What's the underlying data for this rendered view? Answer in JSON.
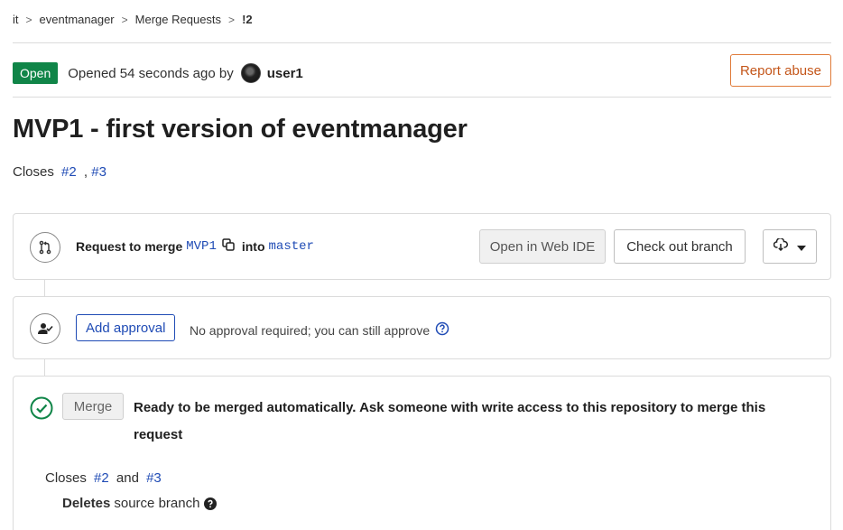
{
  "breadcrumb": {
    "items": [
      "it",
      "eventmanager",
      "Merge Requests",
      "!2"
    ],
    "separator": ">"
  },
  "header": {
    "status": "Open",
    "opened_text": "Opened 54 seconds ago by",
    "author": "user1",
    "report_button": "Report abuse"
  },
  "title": "MVP1 - first version of eventmanager",
  "description": {
    "closes_label": "Closes",
    "issue1": "#2",
    "separator": ",",
    "issue2": "#3"
  },
  "merge_panel": {
    "request_label": "Request to merge",
    "source_branch": "MVP1",
    "into_label": "into",
    "target_branch": "master",
    "web_ide_button": "Open in Web IDE",
    "checkout_button": "Check out branch"
  },
  "approval_panel": {
    "add_approval_button": "Add approval",
    "status_text": "No approval required; you can still approve"
  },
  "ready_panel": {
    "merge_button": "Merge",
    "ready_text": "Ready to be merged automatically. Ask someone with write access to this repository to merge this request",
    "closes_label": "Closes",
    "issue1": "#2",
    "and_label": "and",
    "issue2": "#3",
    "deletes_bold": "Deletes",
    "deletes_rest": "source branch"
  },
  "colors": {
    "status_green": "#108548",
    "link_blue": "#1f4bb5",
    "report_orange": "#e07b3a",
    "check_green": "#108548"
  },
  "icons": {
    "merge_request": "merge-request-icon",
    "copy": "copy-icon",
    "download": "download-icon",
    "chevron": "chevron-down-icon",
    "approval": "approval-icon",
    "help": "question-icon",
    "check": "check-circle-icon"
  }
}
